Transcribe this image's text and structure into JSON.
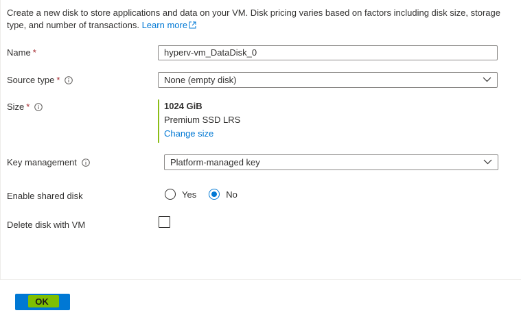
{
  "intro": {
    "text": "Create a new disk to store applications and data on your VM. Disk pricing varies based on factors including disk size, storage type, and number of transactions.",
    "link": "Learn more"
  },
  "name": {
    "label": "Name",
    "required_mark": "*",
    "value": "hyperv-vm_DataDisk_0"
  },
  "source_type": {
    "label": "Source type",
    "required_mark": "*",
    "value": "None (empty disk)"
  },
  "size": {
    "label": "Size",
    "required_mark": "*",
    "value": "1024 GiB",
    "sku": "Premium SSD LRS",
    "change_link": "Change size"
  },
  "key_management": {
    "label": "Key management",
    "value": "Platform-managed key"
  },
  "shared_disk": {
    "label": "Enable shared disk",
    "options": [
      "Yes",
      "No"
    ],
    "selected": "No"
  },
  "delete_with_vm": {
    "label": "Delete disk with VM",
    "checked": false
  },
  "footer": {
    "ok_label": "OK"
  },
  "colors": {
    "accent": "#0078d4",
    "required": "#a4262c",
    "size_bar": "#8cbd18",
    "ok_highlight": "#7fbf00"
  }
}
